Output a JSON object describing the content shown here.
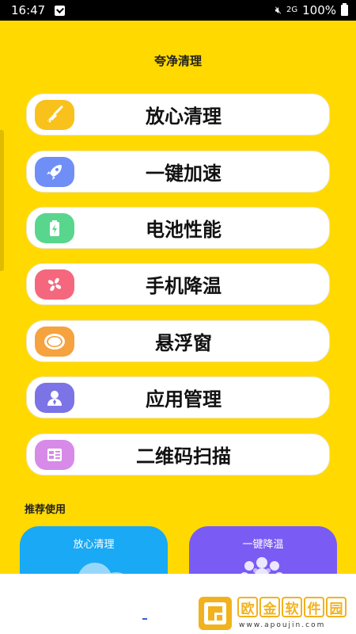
{
  "status_bar": {
    "time": "16:47",
    "signal": "2G",
    "battery": "100%"
  },
  "header": {
    "title": "夸净清理"
  },
  "menu": [
    {
      "label": "放心清理",
      "icon": "broom-icon",
      "color": "#f9c11c"
    },
    {
      "label": "一键加速",
      "icon": "rocket-icon",
      "color": "#6f8ff7"
    },
    {
      "label": "电池性能",
      "icon": "battery-icon",
      "color": "#58d68d"
    },
    {
      "label": "手机降温",
      "icon": "fan-icon",
      "color": "#f4677c"
    },
    {
      "label": "悬浮窗",
      "icon": "float-window-icon",
      "color": "#f5a23f"
    },
    {
      "label": "应用管理",
      "icon": "user-icon",
      "color": "#7c73e6"
    },
    {
      "label": "二维码扫描",
      "icon": "qr-scan-icon",
      "color": "#d78ae8"
    }
  ],
  "recommend": {
    "label": "推荐使用",
    "cards": [
      {
        "label": "放心清理",
        "color": "#1aa9f4"
      },
      {
        "label": "一键降温",
        "color": "#7a5cf4"
      }
    ]
  },
  "watermark": {
    "chars": [
      "欧",
      "金",
      "软",
      "件",
      "园"
    ],
    "url": "www.apoujin.com"
  }
}
